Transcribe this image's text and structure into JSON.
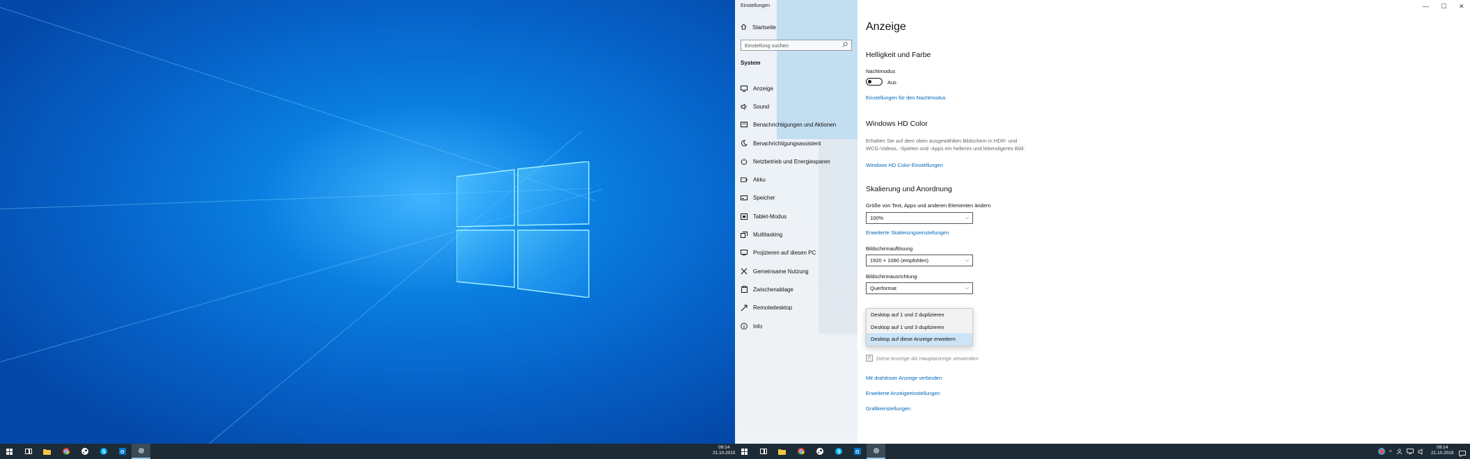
{
  "window": {
    "app_title": "Einstellungen",
    "controls": {
      "minimize": "—",
      "maximize": "☐",
      "close": "✕"
    }
  },
  "sidebar": {
    "home": "Startseite",
    "search_placeholder": "Einstellung suchen",
    "section": "System",
    "items": [
      {
        "label": "Anzeige",
        "icon": "monitor-icon"
      },
      {
        "label": "Sound",
        "icon": "speaker-icon"
      },
      {
        "label": "Benachrichtigungen und Aktionen",
        "icon": "notification-icon"
      },
      {
        "label": "Benachrichtigungsassistent",
        "icon": "moon-icon"
      },
      {
        "label": "Netzbetrieb und Energiesparen",
        "icon": "power-icon"
      },
      {
        "label": "Akku",
        "icon": "battery-icon"
      },
      {
        "label": "Speicher",
        "icon": "storage-icon"
      },
      {
        "label": "Tablet-Modus",
        "icon": "tablet-icon"
      },
      {
        "label": "Multitasking",
        "icon": "multitasking-icon"
      },
      {
        "label": "Projizieren auf diesen PC",
        "icon": "project-icon"
      },
      {
        "label": "Gemeinsame Nutzung",
        "icon": "share-icon"
      },
      {
        "label": "Zwischenablage",
        "icon": "clipboard-icon"
      },
      {
        "label": "Remotedesktop",
        "icon": "remote-icon"
      },
      {
        "label": "Info",
        "icon": "info-icon"
      }
    ]
  },
  "main": {
    "title": "Anzeige",
    "brightness_heading": "Helligkeit und Farbe",
    "night_mode_label": "Nachtmodus",
    "night_mode_state": "Aus",
    "night_mode_link": "Einstellungen für den Nachtmodus",
    "hdr_heading": "Windows HD Color",
    "hdr_description": "Erhalten Sie auf dem oben ausgewählten Bildschirm in HDR- und WCG-Videos, -Spielen und -Apps ein helleres und lebendigeres Bild.",
    "hdr_link": "Windows HD Color-Einstellungen",
    "scale_heading": "Skalierung und Anordnung",
    "scale_label": "Größe von Text, Apps und anderen Elementen ändern",
    "scale_value": "100%",
    "scale_link": "Erweiterte Skalierungseinstellungen",
    "resolution_label": "Bildschirmauflösung",
    "resolution_value": "1920 × 1080 (empfohlen)",
    "orientation_label": "Bildschirmausrichtung",
    "orientation_value": "Querformat",
    "multi_display_options": [
      "Desktop auf 1 und 2 duplizieren",
      "Desktop auf 1 und 3 duplizieren",
      "Desktop auf diese Anzeige erweitern"
    ],
    "multi_display_selected": 2,
    "main_display_checkbox": "Diese Anzeige als Hauptanzeige verwenden",
    "wireless_link": "Mit drahtloser Anzeige verbinden",
    "advanced_display_link": "Erweiterte Anzeigeeinstellungen",
    "graphics_link": "Grafikeinstellungen"
  },
  "taskbar": {
    "clock_time": "09:14",
    "clock_date": "21.10.2019",
    "icons": [
      "windows-start-icon",
      "task-view-icon",
      "file-explorer-icon",
      "chrome-icon",
      "steam-icon",
      "skype-icon",
      "outlook-icon",
      "settings-icon"
    ]
  },
  "colors": {
    "accent": "#0067b8",
    "taskbar": "#1d2b36",
    "wallpaper": "#0662c8",
    "selection": "#cce4f7"
  }
}
